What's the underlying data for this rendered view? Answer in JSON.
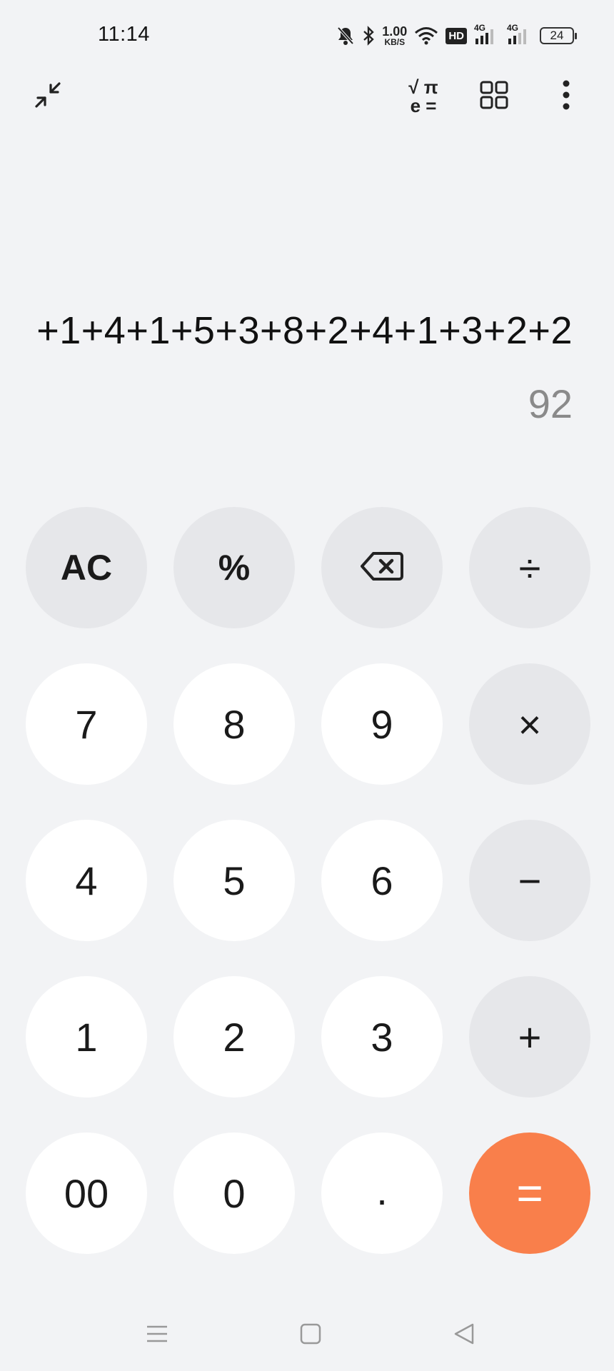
{
  "status": {
    "time": "11:14",
    "speed_value": "1.00",
    "speed_unit": "KB/S",
    "hd_label": "HD",
    "net1": "4G",
    "net2": "4G",
    "battery": "24",
    "icons": [
      "mute-bell-icon",
      "bluetooth-icon",
      "wifi-icon",
      "hd-icon",
      "signal-icon",
      "signal-icon",
      "battery-icon"
    ]
  },
  "toolbar": {
    "icons": [
      "collapse-icon",
      "scientific-icon",
      "grid-icon",
      "more-icon"
    ],
    "sci_top": "√ π",
    "sci_bottom": "e ="
  },
  "display": {
    "expression": "+1+4+1+5+3+8+2+4+1+3+2+2",
    "result": "92"
  },
  "keys": [
    {
      "label": "AC",
      "kind": "op"
    },
    {
      "label": "%",
      "kind": "op"
    },
    {
      "label": "",
      "kind": "op",
      "icon": "backspace-icon"
    },
    {
      "label": "÷",
      "kind": "op"
    },
    {
      "label": "7",
      "kind": "num"
    },
    {
      "label": "8",
      "kind": "num"
    },
    {
      "label": "9",
      "kind": "num"
    },
    {
      "label": "×",
      "kind": "op"
    },
    {
      "label": "4",
      "kind": "num"
    },
    {
      "label": "5",
      "kind": "num"
    },
    {
      "label": "6",
      "kind": "num"
    },
    {
      "label": "−",
      "kind": "op"
    },
    {
      "label": "1",
      "kind": "num"
    },
    {
      "label": "2",
      "kind": "num"
    },
    {
      "label": "3",
      "kind": "num"
    },
    {
      "label": "+",
      "kind": "op"
    },
    {
      "label": "00",
      "kind": "num"
    },
    {
      "label": "0",
      "kind": "num"
    },
    {
      "label": ".",
      "kind": "num"
    },
    {
      "label": "=",
      "kind": "eq"
    }
  ],
  "colors": {
    "accent": "#f97f4b",
    "op_bg": "#e6e7ea",
    "num_bg": "#ffffff",
    "bg": "#f2f3f5"
  },
  "navbar": {
    "icons": [
      "menu-icon",
      "home-icon",
      "back-icon"
    ]
  }
}
